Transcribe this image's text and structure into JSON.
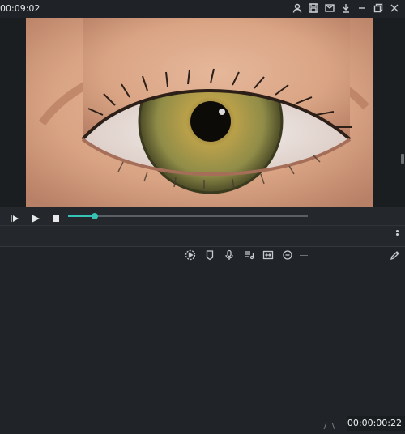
{
  "header": {
    "timecode": "00:09:02",
    "icons": [
      "user-icon",
      "save-icon",
      "mail-icon",
      "download-icon",
      "minimize-icon",
      "restore-icon",
      "close-icon"
    ]
  },
  "player": {
    "playback_progress": 0.11,
    "current_time": "00:00:00:22",
    "controls": [
      "play-prev-icon",
      "play-icon",
      "stop-icon"
    ]
  },
  "toolbar": {
    "icons": [
      "render-preview-icon",
      "marker-icon",
      "microphone-icon",
      "voiceover-list-icon",
      "split-view-icon",
      "zoom-out-icon",
      "edit-pen-icon"
    ]
  },
  "colors": {
    "accent": "#36c2b4",
    "background": "#202428"
  }
}
